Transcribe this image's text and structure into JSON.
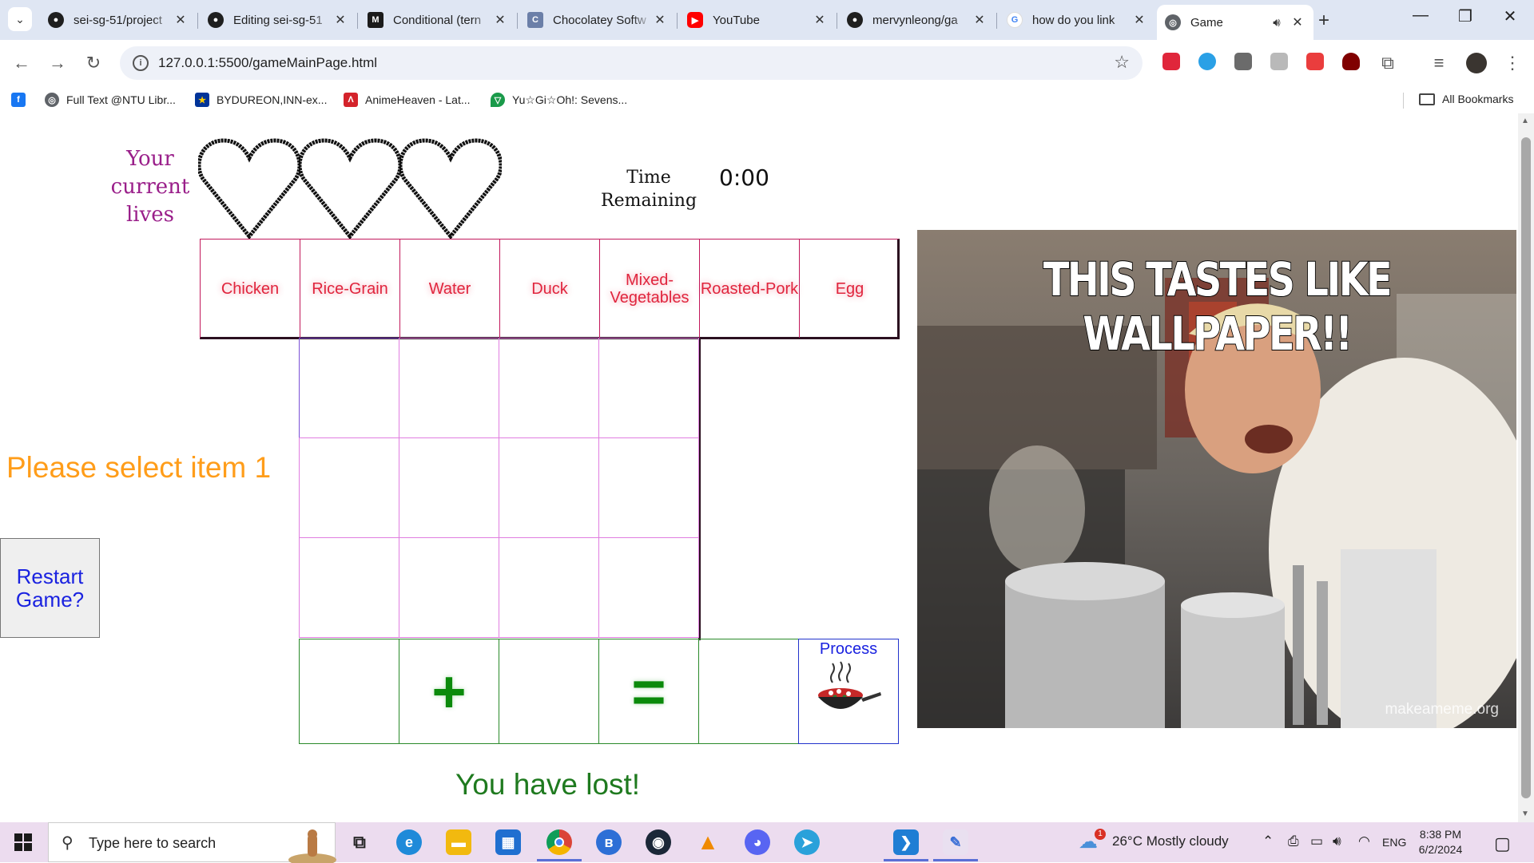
{
  "browser": {
    "tabs": [
      {
        "title": "sei-sg-51/project",
        "icon": "github-icon",
        "color": "#1f1f1f"
      },
      {
        "title": "Editing sei-sg-51",
        "icon": "github-icon",
        "color": "#1f1f1f"
      },
      {
        "title": "Conditional (tern",
        "icon": "mdn-icon",
        "color": "#1b1b1b"
      },
      {
        "title": "Chocolatey Softw",
        "icon": "chocolatey-icon",
        "color": "#6b7fa8"
      },
      {
        "title": "YouTube",
        "icon": "youtube-icon",
        "color": "#ff0000"
      },
      {
        "title": "mervynleong/ga",
        "icon": "github-icon",
        "color": "#1f1f1f"
      },
      {
        "title": "how do you link",
        "icon": "google-icon",
        "color": "#4285f4"
      },
      {
        "title": "Game",
        "icon": "globe-icon",
        "color": "#5f6368",
        "active": true
      }
    ],
    "url": "127.0.0.1:5500/gameMainPage.html",
    "bookmarks": [
      {
        "label": "",
        "icon": "facebook-icon",
        "color": "#1877f2"
      },
      {
        "label": "Full Text @NTU Libr...",
        "icon": "globe-icon",
        "color": "#5f6368"
      },
      {
        "label": "BYDUREON,INN-ex...",
        "icon": "eu-flag-icon",
        "color": "#003399"
      },
      {
        "label": "AnimeHeaven - Lat...",
        "icon": "animeheaven-icon",
        "color": "#d4232b"
      },
      {
        "label": "Yu☆Gi☆Oh!: Sevens...",
        "icon": "yugioh-icon",
        "color": "#1a9a4a"
      }
    ],
    "all_bookmarks": "All Bookmarks"
  },
  "game": {
    "lives_label": "Your current lives",
    "lives_count": 3,
    "time_label": "Time Remaining",
    "time_value": "0:00",
    "ingredients": [
      "Chicken",
      "Rice-Grain",
      "Water",
      "Duck",
      "Mixed-Vegetables",
      "Roasted-Pork",
      "Egg"
    ],
    "prompt": "Please select item 1",
    "restart_label": "Restart Game?",
    "plus_symbol": "+",
    "equals_symbol": "=",
    "process_label": "Process",
    "status_message": "You have lost!",
    "meme_caption": "THIS TASTES LIKE WALLPAPER!!",
    "meme_watermark": "makeameme.org"
  },
  "taskbar": {
    "search_placeholder": "Type here to search",
    "weather": "26°C  Mostly cloudy",
    "weather_badge": "1",
    "language": "ENG",
    "time": "8:38 PM",
    "date": "6/2/2024"
  },
  "colors": {
    "lives_label": "#9a1f8a",
    "ingredient_text": "#e0253d",
    "prompt": "#ff9d1a",
    "restart_text": "#1a22e0",
    "lost": "#1f7a1f",
    "craft_symbol": "#0b8a0b"
  }
}
